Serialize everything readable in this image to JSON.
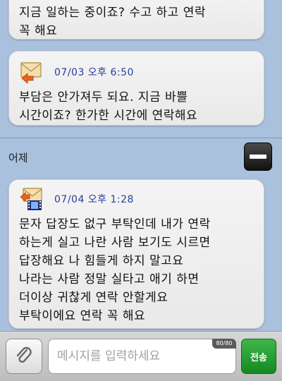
{
  "thread": {
    "messages": [
      {
        "time": "",
        "body": "지금 일하는 중이죠? 수고 하고 연락\n꼭 해요"
      },
      {
        "time": "07/03 오후 6:50",
        "icon": "mail-received-icon",
        "body": "부담은 안가져두 되요. 지금 바쁠\n시간이죠? 한가한 시간에 연락해요"
      },
      {
        "time": "07/04 오후 1:28",
        "icon": "mms-received-icon",
        "body": "문자 답장도 없구 부탁인데 내가 연락\n하는게 실고 나란 사람 보기도 시르면\n답장해요 나 힘들게 하지 말고요\n나라는 사람 정말 실타고 애기 하면\n더이상 귀찮게 연락 안할게요\n부탁이에요 연락 꼭 해요"
      }
    ],
    "date_separator": "어제"
  },
  "input_bar": {
    "placeholder": "메시지를 입력하세요",
    "char_count": "80/80",
    "send_label": "전송"
  },
  "colors": {
    "background": "#a9c1dc",
    "bubble": "#eeeeee",
    "timestamp": "#2a3e9a",
    "send_button": "#1f9e2e",
    "envelope_arrow": "#e8641a"
  }
}
